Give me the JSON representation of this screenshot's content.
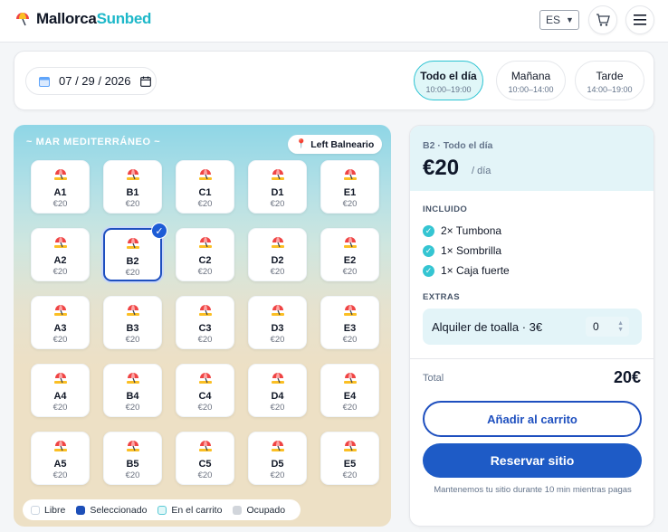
{
  "brand": {
    "part1": "Mallorca",
    "part2": "Sunbed"
  },
  "header": {
    "language": "ES",
    "cart_icon": "cart-icon",
    "menu_icon": "menu-icon"
  },
  "date": {
    "value": "07 / 29 / 2026"
  },
  "time_slots": [
    {
      "label": "Todo el día",
      "hours": "10:00–19:00",
      "active": true
    },
    {
      "label": "Mañana",
      "hours": "10:00–14:00",
      "active": false
    },
    {
      "label": "Tarde",
      "hours": "14:00–19:00",
      "active": false
    }
  ],
  "beach": {
    "sea_label": "~ MAR MEDITERRÁNEO ~",
    "location_chip": "Left Balneario",
    "rows": [
      [
        {
          "code": "A1",
          "price": "€20"
        },
        {
          "code": "B1",
          "price": "€20"
        },
        {
          "code": "C1",
          "price": "€20"
        },
        {
          "code": "D1",
          "price": "€20"
        },
        {
          "code": "E1",
          "price": "€20"
        }
      ],
      [
        {
          "code": "A2",
          "price": "€20"
        },
        {
          "code": "B2",
          "price": "€20",
          "selected": true
        },
        {
          "code": "C2",
          "price": "€20"
        },
        {
          "code": "D2",
          "price": "€20"
        },
        {
          "code": "E2",
          "price": "€20"
        }
      ],
      [
        {
          "code": "A3",
          "price": "€20"
        },
        {
          "code": "B3",
          "price": "€20"
        },
        {
          "code": "C3",
          "price": "€20"
        },
        {
          "code": "D3",
          "price": "€20"
        },
        {
          "code": "E3",
          "price": "€20"
        }
      ],
      [
        {
          "code": "A4",
          "price": "€20"
        },
        {
          "code": "B4",
          "price": "€20"
        },
        {
          "code": "C4",
          "price": "€20"
        },
        {
          "code": "D4",
          "price": "€20"
        },
        {
          "code": "E4",
          "price": "€20"
        }
      ],
      [
        {
          "code": "A5",
          "price": "€20"
        },
        {
          "code": "B5",
          "price": "€20"
        },
        {
          "code": "C5",
          "price": "€20"
        },
        {
          "code": "D5",
          "price": "€20"
        },
        {
          "code": "E5",
          "price": "€20"
        }
      ]
    ],
    "legend": {
      "free": "Libre",
      "selected": "Seleccionado",
      "in_cart": "En el carrito",
      "occupied": "Ocupado"
    }
  },
  "summary": {
    "subtitle": "B2 · Todo el día",
    "price": "€20",
    "per": "/ día",
    "included_label": "INCLUIDO",
    "included": [
      "2× Tumbona",
      "1× Sombrilla",
      "1× Caja fuerte"
    ],
    "extras_label": "EXTRAS",
    "extra": {
      "label": "Alquiler de toalla · 3€",
      "quantity": "0"
    },
    "total_label": "Total",
    "total_value": "20€",
    "add_to_cart": "Añadir al carrito",
    "reserve": "Reservar sitio",
    "note": "Mantenemos tu sitio durante 10 min mientras pagas"
  },
  "colors": {
    "accent": "#1e5bc6",
    "teal": "#2cc3d2"
  }
}
